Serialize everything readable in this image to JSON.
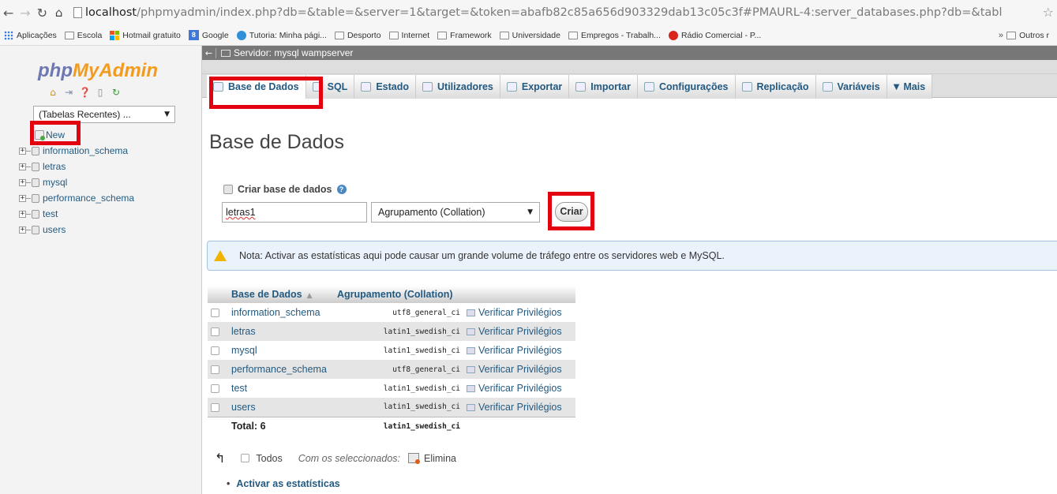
{
  "browser": {
    "url_host": "localhost",
    "url_rest": "/phpmyadmin/index.php?db=&table=&server=1&target=&token=abafb82c85a656d903329dab13c05c3f#PMAURL-4:server_databases.php?db=&tabl",
    "bookmarks": [
      {
        "label": "Aplicações",
        "icon": "apps-icon"
      },
      {
        "label": "Escola",
        "icon": "folder-icon"
      },
      {
        "label": "Hotmail gratuito",
        "icon": "microsoft-icon"
      },
      {
        "label": "Google",
        "icon": "google-icon"
      },
      {
        "label": "Tutoria: Minha pági...",
        "icon": "globe-icon"
      },
      {
        "label": "Desporto",
        "icon": "folder-icon"
      },
      {
        "label": "Internet",
        "icon": "folder-icon"
      },
      {
        "label": "Framework",
        "icon": "folder-icon"
      },
      {
        "label": "Universidade",
        "icon": "folder-icon"
      },
      {
        "label": "Empregos - Trabalh...",
        "icon": "folder-icon"
      },
      {
        "label": "Rádio Comercial - P...",
        "icon": "radio-icon"
      }
    ],
    "more": "»",
    "others": "Outros r"
  },
  "sidebar": {
    "logo_a": "php",
    "logo_b": "MyAdmin",
    "recent_select": "(Tabelas Recentes) ...",
    "new_label": "New",
    "databases": [
      "information_schema",
      "letras",
      "mysql",
      "performance_schema",
      "test",
      "users"
    ]
  },
  "server_bar": {
    "label": "Servidor: mysql wampserver"
  },
  "tabs": [
    {
      "label": "Base de Dados",
      "icon": "database-icon"
    },
    {
      "label": "SQL",
      "icon": "sql-icon"
    },
    {
      "label": "Estado",
      "icon": "status-icon"
    },
    {
      "label": "Utilizadores",
      "icon": "users-icon"
    },
    {
      "label": "Exportar",
      "icon": "export-icon"
    },
    {
      "label": "Importar",
      "icon": "import-icon"
    },
    {
      "label": "Configurações",
      "icon": "wrench-icon"
    },
    {
      "label": "Replicação",
      "icon": "replication-icon"
    },
    {
      "label": "Variáveis",
      "icon": "variables-icon"
    },
    {
      "label": "Mais",
      "icon": "chevron-down-icon"
    }
  ],
  "main": {
    "title": "Base de Dados",
    "create_label": "Criar base de dados",
    "db_name_value": "letras1",
    "collation_select": "Agrupamento (Collation)",
    "create_button": "Criar",
    "notice": "Nota: Activar as estatísticas aqui pode causar um grande volume de tráfego entre os servidores web e MySQL."
  },
  "table": {
    "headers": [
      "Base de Dados",
      "Agrupamento (Collation)"
    ],
    "rows": [
      {
        "name": "information_schema",
        "collation": "utf8_general_ci",
        "action": "Verificar Privilégios"
      },
      {
        "name": "letras",
        "collation": "latin1_swedish_ci",
        "action": "Verificar Privilégios"
      },
      {
        "name": "mysql",
        "collation": "latin1_swedish_ci",
        "action": "Verificar Privilégios"
      },
      {
        "name": "performance_schema",
        "collation": "utf8_general_ci",
        "action": "Verificar Privilégios"
      },
      {
        "name": "test",
        "collation": "latin1_swedish_ci",
        "action": "Verificar Privilégios"
      },
      {
        "name": "users",
        "collation": "latin1_swedish_ci",
        "action": "Verificar Privilégios"
      }
    ],
    "total_label": "Total: 6",
    "total_collation": "latin1_swedish_ci"
  },
  "bulk": {
    "all_label": "Todos",
    "with_selected": "Com os seleccionados:",
    "delete_label": "Elimina"
  },
  "stats_link": "Activar as estatísticas",
  "colors": {
    "link": "#235a81",
    "annotation": "#e3000f",
    "logo_blue": "#6c78af",
    "logo_orange": "#f29b1e"
  }
}
